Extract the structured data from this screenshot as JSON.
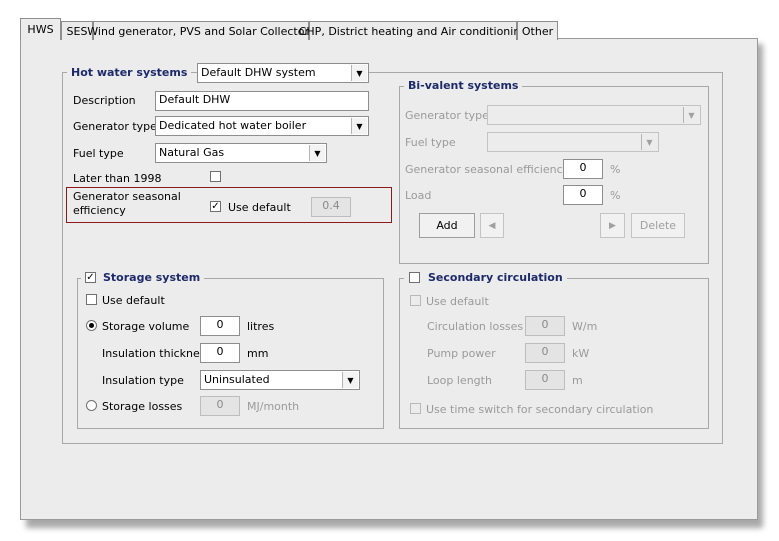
{
  "tabs": [
    "HWS",
    "SES",
    "Wind generator, PVS and Solar Collectors",
    "CHP, District heating and Air conditioning",
    "Other"
  ],
  "hot_water": {
    "legend": "Hot water systems",
    "system_select": "Default DHW system",
    "description_label": "Description",
    "description_value": "Default DHW",
    "generator_type_label": "Generator type",
    "generator_type_value": "Dedicated hot water boiler",
    "fuel_type_label": "Fuel type",
    "fuel_type_value": "Natural Gas",
    "later_than_label": "Later than 1998",
    "later_than_checked": false,
    "efficiency_label_1": "Generator seasonal",
    "efficiency_label_2": "efficiency",
    "use_default_label": "Use default",
    "use_default_checked": true,
    "efficiency_value": "0.4"
  },
  "bivalent": {
    "legend": "Bi-valent systems",
    "generator_type_label": "Generator type",
    "fuel_type_label": "Fuel type",
    "efficiency_label": "Generator seasonal efficiency",
    "efficiency_value": "0",
    "efficiency_unit": "%",
    "load_label": "Load",
    "load_value": "0",
    "load_unit": "%",
    "add_button": "Add",
    "prev_button": "◀",
    "next_button": "▶",
    "delete_button": "Delete"
  },
  "storage": {
    "legend": "Storage system",
    "legend_checked": true,
    "use_default_label": "Use default",
    "storage_volume_label": "Storage volume",
    "storage_volume_value": "0",
    "storage_volume_unit": "litres",
    "insulation_thickness_label": "Insulation thickness",
    "insulation_thickness_value": "0",
    "insulation_thickness_unit": "mm",
    "insulation_type_label": "Insulation type",
    "insulation_type_value": "Uninsulated",
    "storage_losses_label": "Storage losses",
    "storage_losses_value": "0",
    "storage_losses_unit": "MJ/month"
  },
  "secondary": {
    "legend": "Secondary circulation",
    "legend_checked": false,
    "use_default_label": "Use default",
    "circulation_losses_label": "Circulation losses",
    "circulation_losses_value": "0",
    "circulation_losses_unit": "W/m",
    "pump_power_label": "Pump power",
    "pump_power_value": "0",
    "pump_power_unit": "kW",
    "loop_length_label": "Loop length",
    "loop_length_value": "0",
    "loop_length_unit": "m",
    "time_switch_label": "Use time switch for secondary circulation"
  }
}
